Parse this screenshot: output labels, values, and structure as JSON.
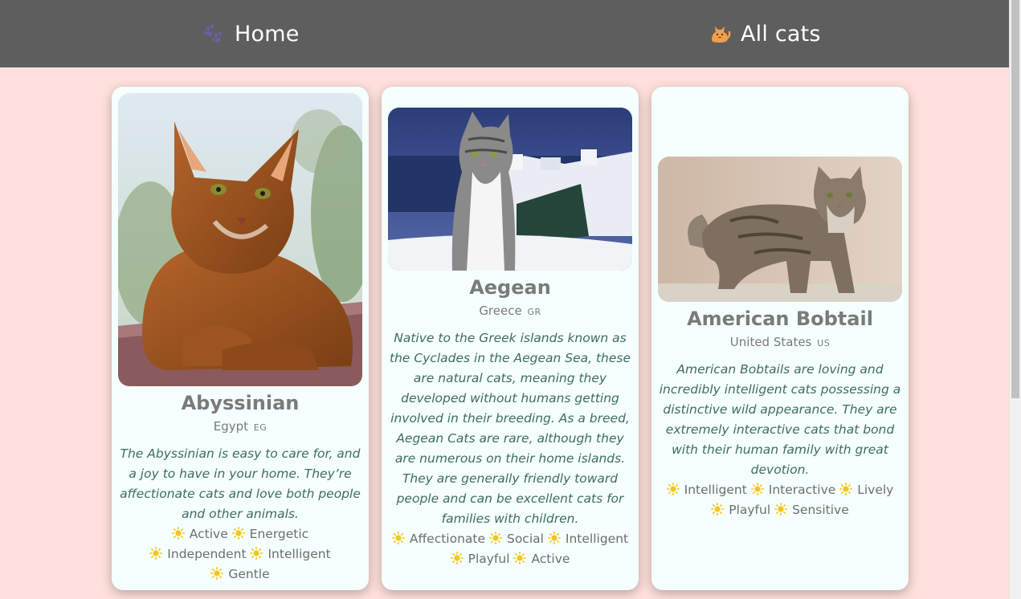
{
  "nav": {
    "home_label": "Home",
    "home_icon": "paw-prints-icon",
    "all_cats_label": "All cats",
    "all_cats_icon": "cat-face-icon"
  },
  "colors": {
    "navbar_bg": "#5e5e5e",
    "page_bg": "#ffe0dc",
    "card_bg": "#f5fffd",
    "name_color": "#7a7a7a",
    "description_color": "#3e6b63",
    "trait_icon_color": "#f5c518"
  },
  "trait_icon": "sun-icon",
  "cats": [
    {
      "name": "Abyssinian",
      "origin": "Egypt",
      "country_code": "EG",
      "description": "The Abyssinian is easy to care for, and a joy to have in your home. They’re affectionate cats and love both people and other animals.",
      "temperament": [
        "Active",
        "Energetic",
        "Independent",
        "Intelligent",
        "Gentle"
      ]
    },
    {
      "name": "Aegean",
      "origin": "Greece",
      "country_code": "GR",
      "description": "Native to the Greek islands known as the Cyclades in the Aegean Sea, these are natural cats, meaning they developed without humans getting involved in their breeding. As a breed, Aegean Cats are rare, although they are numerous on their home islands. They are generally friendly toward people and can be excellent cats for families with children.",
      "temperament": [
        "Affectionate",
        "Social",
        "Intelligent",
        "Playful",
        "Active"
      ]
    },
    {
      "name": "American Bobtail",
      "origin": "United States",
      "country_code": "US",
      "description": "American Bobtails are loving and incredibly intelligent cats possessing a distinctive wild appearance. They are extremely interactive cats that bond with their human family with great devotion.",
      "temperament": [
        "Intelligent",
        "Interactive",
        "Lively",
        "Playful",
        "Sensitive"
      ]
    }
  ]
}
